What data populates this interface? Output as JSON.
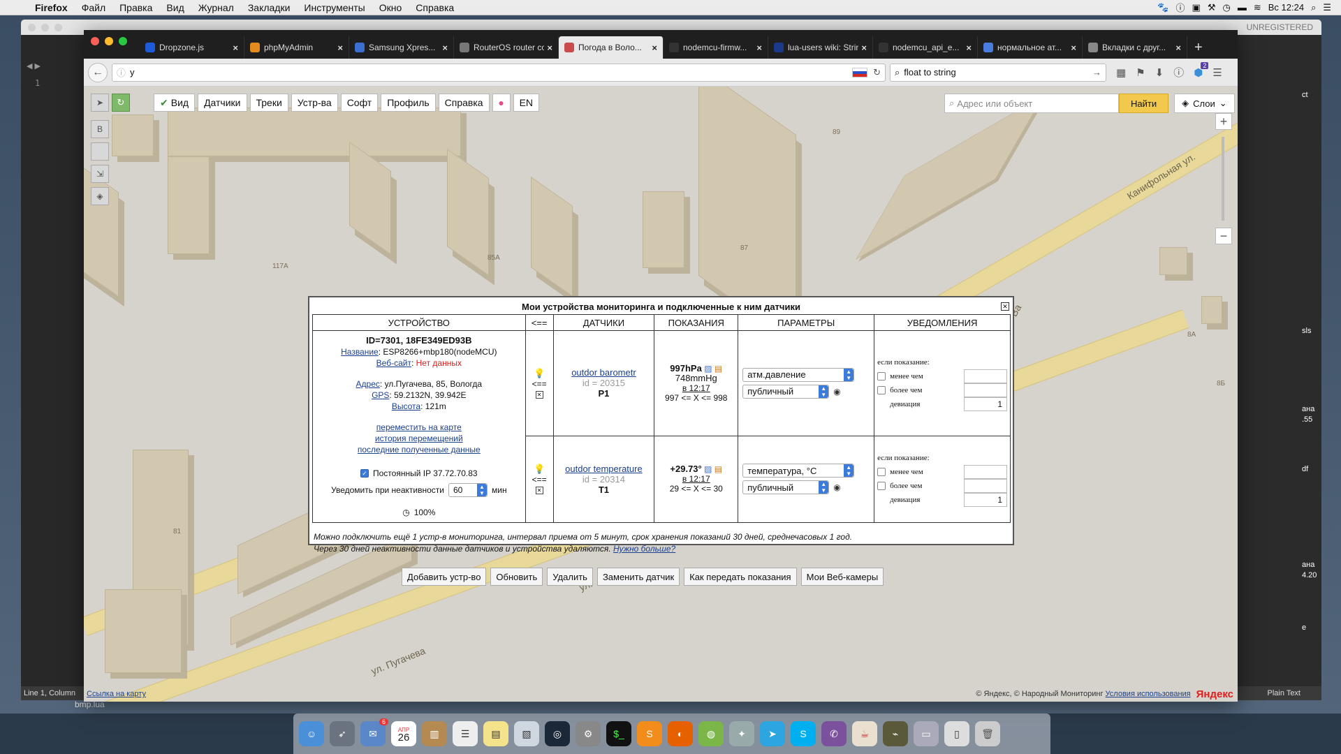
{
  "menubar": {
    "app": "Firefox",
    "items": [
      "Файл",
      "Правка",
      "Вид",
      "Журнал",
      "Закладки",
      "Инструменты",
      "Окно",
      "Справка"
    ],
    "clock": "Вс 12:24"
  },
  "editor": {
    "unregistered": "UNREGISTERED",
    "line_number": "1",
    "status_left": "Line 1, Column",
    "status_right": "Plain Text",
    "filename": "bmp.lua",
    "side_text": [
      "ct",
      "sls",
      "ана",
      ".55",
      "df",
      "ана",
      "4.20",
      "e"
    ]
  },
  "browser": {
    "tabs": [
      {
        "label": "Dropzone.js",
        "active": false
      },
      {
        "label": "phpMyAdmin",
        "active": false
      },
      {
        "label": "Samsung Xpres...",
        "active": false
      },
      {
        "label": "RouterOS router co...",
        "active": false
      },
      {
        "label": "Погода в Воло...",
        "active": true
      },
      {
        "label": "nodemcu-firmw...",
        "active": false
      },
      {
        "label": "lua-users wiki: Strin...",
        "active": false
      },
      {
        "label": "nodemcu_api_e...",
        "active": false
      },
      {
        "label": "нормальное ат...",
        "active": false
      },
      {
        "label": "Вкладки с друг...",
        "active": false
      }
    ],
    "url": "y",
    "search": "float to string",
    "badge": "2"
  },
  "map": {
    "toolbar": [
      "Вид",
      "Датчики",
      "Треки",
      "Устр-ва",
      "Софт",
      "Профиль",
      "Справка",
      "EN"
    ],
    "search_placeholder": "Адрес или объект",
    "find": "Найти",
    "layers": "Слои",
    "labels": [
      "89",
      "117А",
      "85А",
      "87",
      "8А",
      "8Б",
      "81"
    ],
    "streets": [
      "Канифольная ул.",
      "ул. Пугачева",
      "ул.",
      "Ва"
    ],
    "link_bottom": "Ссылка на карту",
    "copyright": "© Яндекс, © Народный Мониторинг",
    "terms": "Условия использования",
    "yandex": "Яндекс"
  },
  "dialog": {
    "title": "Мои устройства мониторинга и подключенные к ним датчики",
    "headers": {
      "device": "УСТРОЙСТВО",
      "arrow": "<==",
      "sensors": "ДАТЧИКИ",
      "readings": "ПОКАЗАНИЯ",
      "params": "ПАРАМЕТРЫ",
      "notify": "УВЕДОМЛЕНИЯ"
    },
    "device": {
      "id": "ID=7301, 18FE349ED93B",
      "name_label": "Название",
      "name_value": ": ESP8266+mbp180(nodeMCU)",
      "site_label": "Веб-сайт",
      "site_value": "Нет данных",
      "addr_label": "Адрес",
      "addr_value": ": ул.Пугачева, 85, Вологда",
      "gps_label": "GPS",
      "gps_value": ": 59.2132N, 39.942E",
      "alt_label": "Высота",
      "alt_value": ": 121m",
      "link_move": "переместить на карте",
      "link_history": "история перемещений",
      "link_last": "последние полученные данные",
      "static_ip": "Постоянный IP 37.72.70.83",
      "notify_inactive": "Уведомить при неактивности",
      "inactive_value": "60",
      "inactive_unit": "мин",
      "battery": "100%"
    },
    "arrow_symbol": "<==",
    "sensors": [
      {
        "name": "outdor barometr",
        "id": "id = 20315",
        "code": "P1",
        "value_main": "997hPa",
        "value_alt": "748mmHg",
        "time": "в 12:17",
        "range": "997 <= X <= 998",
        "param_type": "атм.давление",
        "visibility": "публичный",
        "notify_label": "если показание:",
        "less": "менее чем",
        "more": "более чем",
        "dev": "девиация",
        "dev_value": "1"
      },
      {
        "name": "outdor temperature",
        "id": "id = 20314",
        "code": "T1",
        "value_main": "+29.73°",
        "value_alt": "",
        "time": "в 12:17",
        "range": "29 <= X <= 30",
        "param_type": "температура, °C",
        "visibility": "публичный",
        "notify_label": "если показание:",
        "less": "менее чем",
        "more": "более чем",
        "dev": "девиация",
        "dev_value": "1"
      }
    ],
    "note1": "Можно подключить ещё 1 устр-в мониторинга, интервал приема от 5 минут, срок хранения показаний 30 дней, среднечасовых 1 год.",
    "note2": "Через 30 дней неактивности данные датчиков и устройства удаляются.",
    "note2_link": "Нужно больше?",
    "buttons": [
      "Добавить устр-во",
      "Обновить",
      "Удалить",
      "Заменить датчик",
      "Как передать показания",
      "Мои Веб-камеры"
    ]
  },
  "dock": {
    "calendar_month": "АПР",
    "calendar_day": "26",
    "badge": "6"
  }
}
